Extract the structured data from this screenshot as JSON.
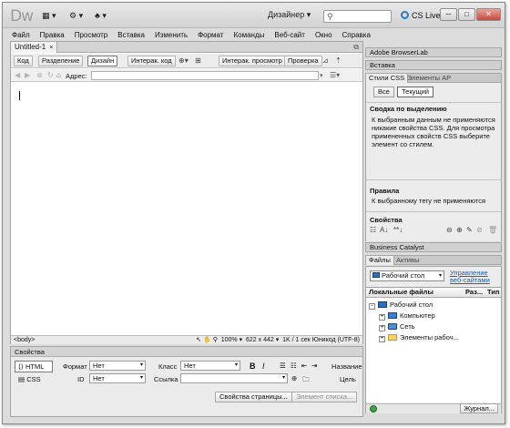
{
  "app": {
    "logo": "Dw",
    "workspace": "Дизайнер",
    "search_placeholder": "",
    "cslive": "CS Live",
    "win_min": "─",
    "win_max": "□",
    "win_close": "✕"
  },
  "menu": [
    "Файл",
    "Правка",
    "Просмотр",
    "Вставка",
    "Изменить",
    "Формат",
    "Команды",
    "Веб-сайт",
    "Окно",
    "Справка"
  ],
  "document": {
    "tab_title": "Untitled-1",
    "tab_close": "×",
    "view_buttons": {
      "code": "Код",
      "split": "Разделение",
      "design": "Дизайн",
      "live_code": "Интерак. код",
      "live_view": "Интерак. просмотр",
      "check": "Проверка"
    },
    "address_label": "Адрес:",
    "address_value": "",
    "status": {
      "tag": "<body>",
      "zoom": "100%",
      "size": "622 x 442",
      "info": "1K / 1 сек  Юникод (UTF-8)"
    }
  },
  "properties": {
    "title": "Свойства",
    "html_btn": "HTML",
    "css_btn": "CSS",
    "format_label": "Формат",
    "format_value": "Нет",
    "class_label": "Класс",
    "class_value": "Нет",
    "id_label": "ID",
    "id_value": "Нет",
    "link_label": "Ссылка",
    "link_value": "",
    "title_label": "Название",
    "target_label": "Цель",
    "bold": "B",
    "italic": "I",
    "page_props_btn": "Свойства страницы...",
    "list_item_btn": "Элемент списка..."
  },
  "right_panel": {
    "browserlab": "Adobe BrowserLab",
    "insert": "Вставка",
    "css_tab": "Стили CSS",
    "ap_tab": "Элементы AP",
    "all_btn": "Все",
    "current_btn": "Текущий",
    "summary_title": "Сводка по выделению",
    "summary_text": "К выбранным данным не применяются никакие свойства CSS.  Для просмотра примененных свойств CSS выберите элемент со стилем.",
    "rules_title": "Правила",
    "rules_text": "К выбранному тегу не применяются",
    "properties_title": "Свойства",
    "business_catalyst": "Business Catalyst",
    "files_tab": "Файлы",
    "assets_tab": "Активы",
    "site": "Рабочий стол",
    "manage_sites": "Управление веб-сайтами",
    "col_local": "Локальные файлы",
    "col_size": "Раз...",
    "col_type": "Тип",
    "tree": [
      {
        "label": "Рабочий стол",
        "icon": "desktop-icon",
        "expander": "−"
      },
      {
        "label": "Компьютер",
        "icon": "computer-icon",
        "expander": "+"
      },
      {
        "label": "Сеть",
        "icon": "network-icon",
        "expander": "+"
      },
      {
        "label": "Элементы рабоч...",
        "icon": "folder-icon",
        "expander": "+"
      }
    ],
    "log_btn": "Журнал..."
  }
}
